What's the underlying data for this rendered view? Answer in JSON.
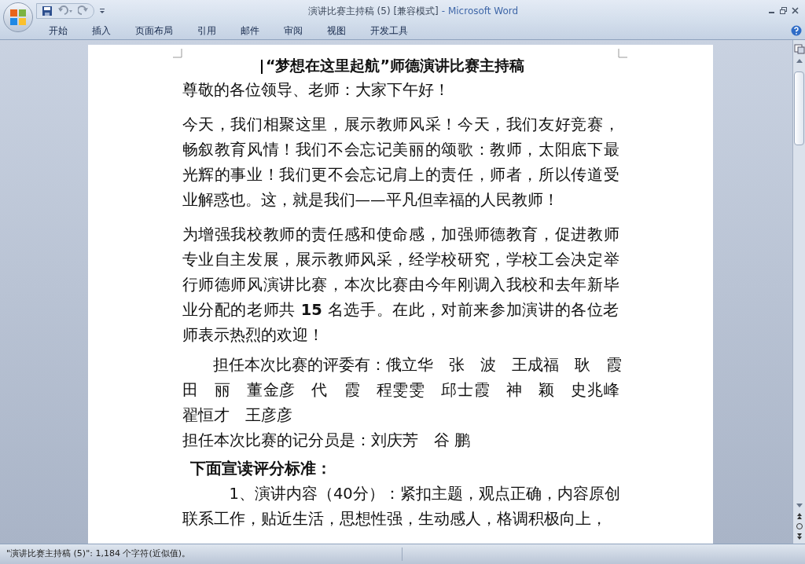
{
  "window": {
    "title": "演讲比赛主持稿 (5) [兼容模式]",
    "app": "- Microsoft Word"
  },
  "ribbon_tabs": [
    {
      "label": "开始",
      "selected": false
    },
    {
      "label": "插入",
      "selected": false
    },
    {
      "label": "页面布局",
      "selected": false
    },
    {
      "label": "引用",
      "selected": false
    },
    {
      "label": "邮件",
      "selected": false
    },
    {
      "label": "审阅",
      "selected": false
    },
    {
      "label": "视图",
      "selected": false
    },
    {
      "label": "开发工具",
      "selected": false
    }
  ],
  "document": {
    "title": "“梦想在这里起航”师德演讲比赛主持稿",
    "paragraphs": [
      {
        "kind": "plain",
        "text": "尊敬的各位领导、老师：大家下午好！"
      },
      {
        "kind": "spaced",
        "text": "今天，我们相聚这里，展示教师风采！今天，我们友好竞赛，畅叙教育风情！我们不会忘记美丽的颂歌：教师，太阳底下最光辉的事业！我们更不会忘记肩上的责任，师者，所以传道受业解惑也。这，就是我们——平凡但幸福的人民教师！"
      },
      {
        "kind": "spaced",
        "text": "为增强我校教师的责任感和使命感，加强师德教育，促进教师专业自主发展，展示教师风采，经学校研究，学校工会决定举行师德师风演讲比赛，本次比赛由今年刚调入我校和去年新毕业分配的老师共 **15** 名选手。在此，对前来参加演讲的各位老师表示热烈的欢迎！"
      },
      {
        "kind": "lines",
        "lines": [
          "担任本次比赛的评委有：俄立华　张　波　王成福　耿　霞",
          "田　丽　董金彦　代　霞　程雯雯　邱士霞　神　颖　史兆峰",
          "翟恒才　王彦彦"
        ]
      },
      {
        "kind": "plain",
        "text": "担任本次比赛的记分员是：刘庆芳　谷 鹏"
      },
      {
        "kind": "heading",
        "text": "下面宣读评分标准："
      }
    ],
    "lines": [
      "1、演讲内容（40分）：紧扣主题，观点正确，内容原创",
      "联系工作，贴近生活，思想性强，生动感人，格调积极向上，"
    ]
  },
  "status_bar": "\"演讲比赛主持稿 (5)\": 1,184 个字符(近似值)。"
}
